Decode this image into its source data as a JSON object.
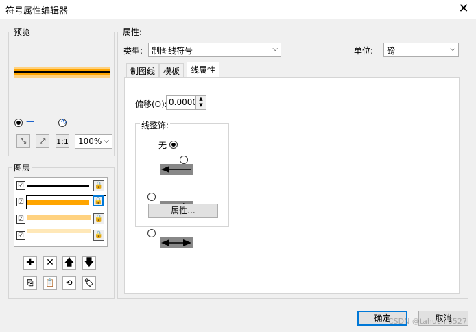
{
  "window": {
    "title": "符号属性编辑器"
  },
  "preview": {
    "group_label": "预览",
    "mode_line_label": "—",
    "mode_wave_label": "∿",
    "zoom": "100%",
    "colors": {
      "line_black": "#000000",
      "line_orange": "#ffa500",
      "line_light": "#ffd280"
    }
  },
  "layers": {
    "group_label": "图层",
    "items": [
      {
        "checked": "☑",
        "color": "#000000"
      },
      {
        "checked": "☑",
        "color": "#ffa500"
      },
      {
        "checked": "☑",
        "color": "#ffd280"
      },
      {
        "checked": "☑",
        "color": "#ffe8b8"
      }
    ]
  },
  "properties": {
    "group_label": "属性:",
    "type_label": "类型:",
    "type_value": "制图线符号",
    "unit_label": "单位:",
    "unit_value": "磅",
    "tabs": [
      "制图线",
      "模板",
      "线属性"
    ],
    "offset_label": "偏移(O):",
    "offset_value": "0.0000",
    "decoration_label": "线整饰:",
    "decoration_none": "无",
    "attributes_button": "属性..."
  },
  "footer": {
    "ok": "确定",
    "cancel": "取消",
    "watermark": "CSDN @tahuchi6527"
  }
}
